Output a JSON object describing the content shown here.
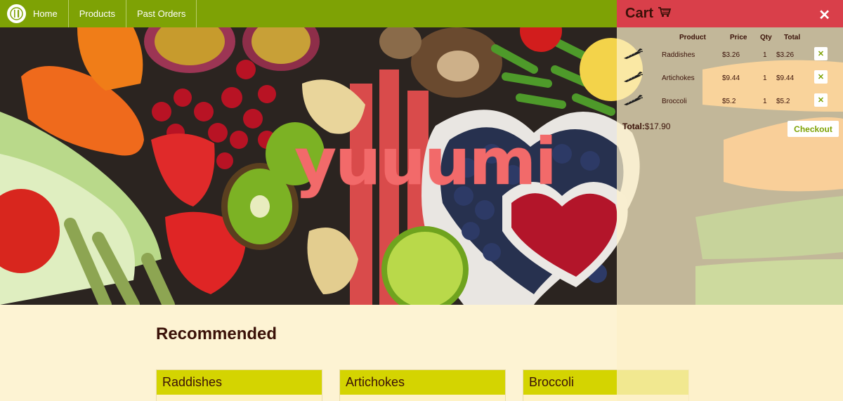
{
  "nav": {
    "items": [
      {
        "label": "Home"
      },
      {
        "label": "Products"
      },
      {
        "label": "Past Orders"
      }
    ]
  },
  "hero": {
    "title": "yuuumi"
  },
  "main": {
    "section_title": "Recommended",
    "cards": [
      {
        "name": "Raddishes"
      },
      {
        "name": "Artichokes"
      },
      {
        "name": "Broccoli"
      }
    ]
  },
  "cart": {
    "title": "Cart",
    "close_label": "✕",
    "columns": {
      "product": "Product",
      "price": "Price",
      "qty": "Qty",
      "total": "Total"
    },
    "items": [
      {
        "product": "Raddishes",
        "price": "$3.26",
        "qty": "1",
        "total": "$3.26"
      },
      {
        "product": "Artichokes",
        "price": "$9.44",
        "qty": "1",
        "total": "$9.44"
      },
      {
        "product": "Broccoli",
        "price": "$5.2",
        "qty": "1",
        "total": "$5.2"
      }
    ],
    "remove_label": "✕",
    "total_label": "Total:",
    "total_value": "$17.90",
    "checkout_label": "Checkout"
  },
  "colors": {
    "nav": "#7ea205",
    "cart_header": "#d93f4a",
    "card_header": "#d4d401",
    "page_bg": "#fdf3d3",
    "hero_title": "#f26a6a"
  }
}
